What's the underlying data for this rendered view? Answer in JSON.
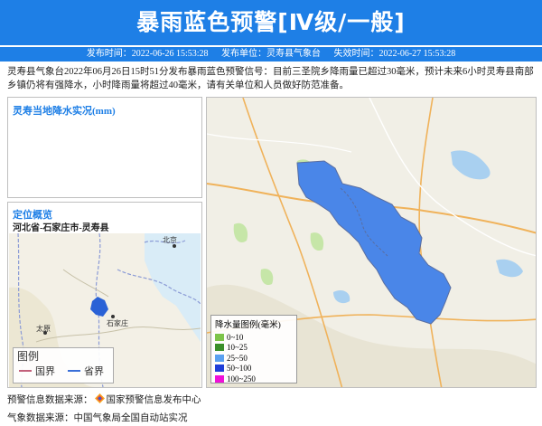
{
  "header": {
    "title": "暴雨蓝色预警[Ⅳ级/一般]"
  },
  "meta": {
    "issue_time_label": "发布时间：",
    "issue_time": "2022-06-26 15:53:28",
    "issuer_label": "发布单位：",
    "issuer": "灵寿县气象台",
    "expire_label": "失效时间：",
    "expire_time": "2022-06-27 15:53:28"
  },
  "description": "灵寿县气象台2022年06月26日15时51分发布暴雨蓝色预警信号：目前三圣院乡降雨量已超过30毫米，预计未来6小时灵寿县南部乡镇仍将有强降水，小时降雨量将超过40毫米，请有关单位和人员做好防范准备。",
  "rain_panel": {
    "title": "灵寿当地降水实况(mm)"
  },
  "location_panel": {
    "title": "定位概览",
    "path": "河北省-石家庄市-灵寿县",
    "labels": {
      "beijing": "北京",
      "shijiazhuang": "石家庄",
      "taiyuan": "太原"
    },
    "legend": {
      "title": "图例",
      "national": "国界",
      "provincial": "省界"
    }
  },
  "main_map": {
    "legend_title": "降水量图例(毫米)",
    "legend_items": [
      {
        "label": "0~10",
        "color": "#7dc44a"
      },
      {
        "label": "10~25",
        "color": "#3a8f2a"
      },
      {
        "label": "25~50",
        "color": "#5aa0f0"
      },
      {
        "label": "50~100",
        "color": "#1f3ed8"
      },
      {
        "label": "100~250",
        "color": "#f010d8"
      }
    ],
    "rain_color": "#4a86e8"
  },
  "footer": {
    "source_label": "预警信息数据来源：",
    "source": "国家预警信息发布中心",
    "weather_label": "气象数据来源：",
    "weather": "中国气象局全国自动站实况"
  }
}
